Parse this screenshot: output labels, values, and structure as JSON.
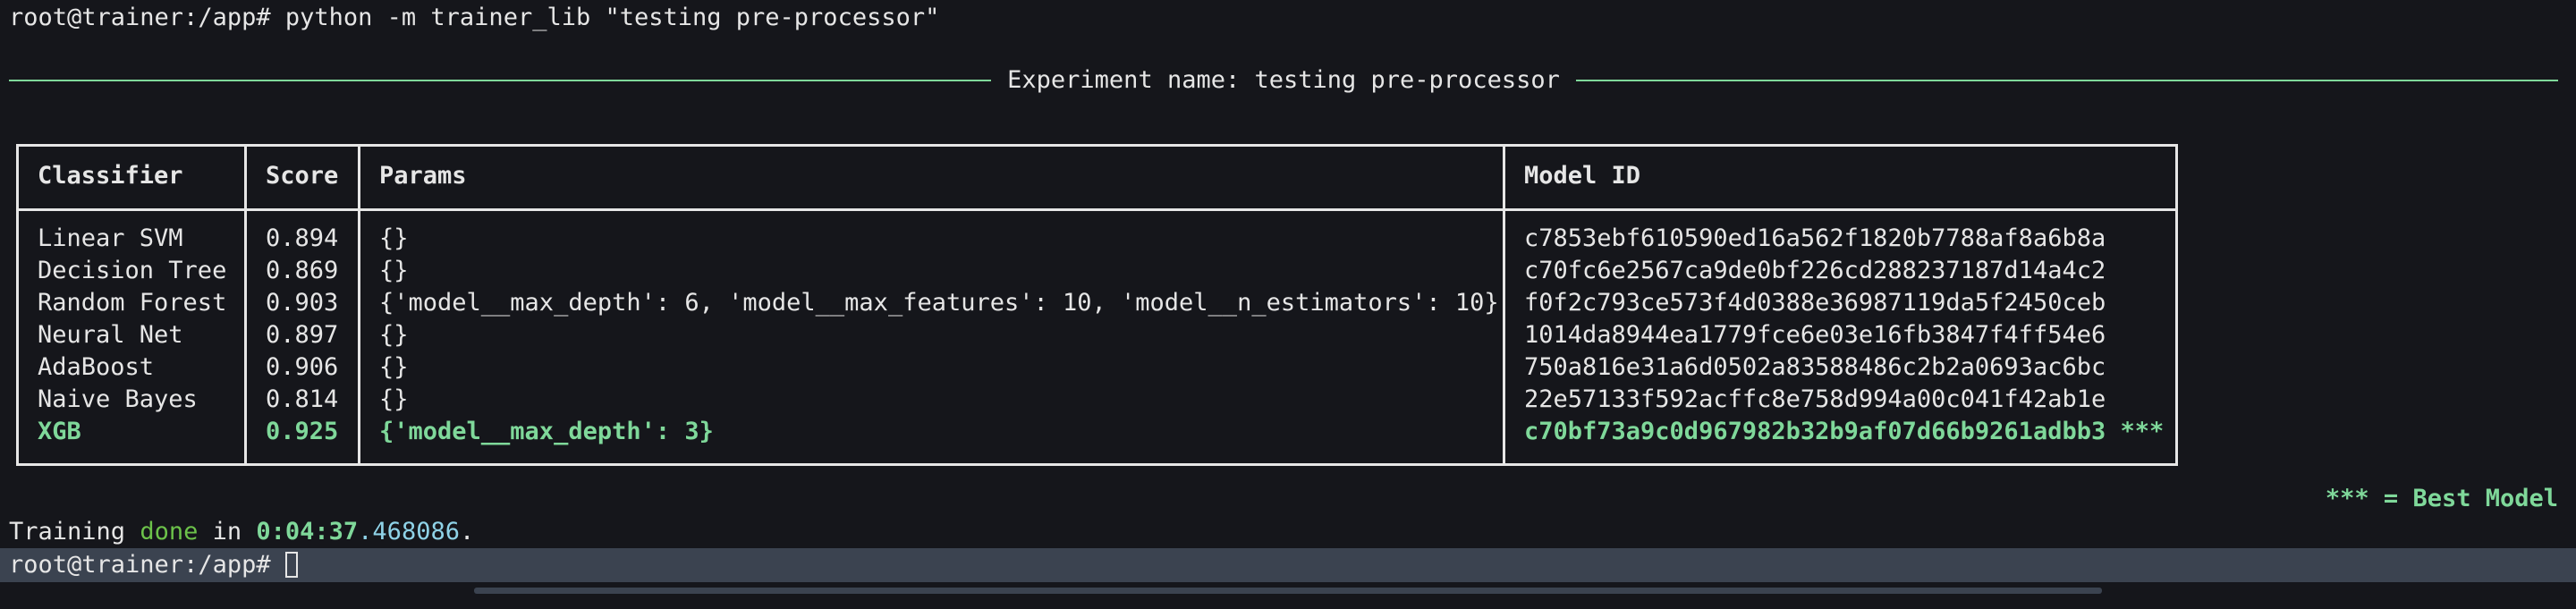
{
  "terminal": {
    "command_prompt": "root@trainer:/app# ",
    "command": "python -m trainer_lib \"testing pre-processor\"",
    "experiment_title": "Experiment name: testing pre-processor"
  },
  "table": {
    "headers": {
      "classifier": "Classifier",
      "score": "Score",
      "params": "Params",
      "model_id": "Model ID"
    },
    "rows": [
      {
        "classifier": "Linear SVM",
        "score": "0.894",
        "params": "{}",
        "model_id": "c7853ebf610590ed16a562f1820b7788af8a6b8a",
        "best": false
      },
      {
        "classifier": "Decision Tree",
        "score": "0.869",
        "params": "{}",
        "model_id": "c70fc6e2567ca9de0bf226cd288237187d14a4c2",
        "best": false
      },
      {
        "classifier": "Random Forest",
        "score": "0.903",
        "params": "{'model__max_depth': 6, 'model__max_features': 10, 'model__n_estimators': 10}",
        "model_id": "f0f2c793ce573f4d0388e36987119da5f2450ceb",
        "best": false
      },
      {
        "classifier": "Neural Net",
        "score": "0.897",
        "params": "{}",
        "model_id": "1014da8944ea1779fce6e03e16fb3847f4ff54e6",
        "best": false
      },
      {
        "classifier": "AdaBoost",
        "score": "0.906",
        "params": "{}",
        "model_id": "750a816e31a6d0502a83588486c2b2a0693ac6bc",
        "best": false
      },
      {
        "classifier": "Naive Bayes",
        "score": "0.814",
        "params": "{}",
        "model_id": "22e57133f592acffc8e758d994a00c041f42ab1e",
        "best": false
      },
      {
        "classifier": "XGB",
        "score": "0.925",
        "params": "{'model__max_depth': 3}",
        "model_id": "c70bf73a9c0d967982b32b9af07d66b9261adbb3 ***",
        "best": true
      }
    ],
    "legend": "*** = Best Model"
  },
  "training": {
    "prefix": "Training ",
    "done": "done",
    "in": " in ",
    "time_main": "0:04:37",
    "time_frac": ".468086",
    "suffix": "."
  },
  "prompt": {
    "text": "root@trainer:/app# "
  },
  "colors": {
    "background": "#15161b",
    "text": "#e6e6e6",
    "accent_green": "#7fd89a",
    "done_green": "#6cc24a",
    "cyan": "#8fd3e8",
    "prompt_bar": "#3b4350"
  }
}
